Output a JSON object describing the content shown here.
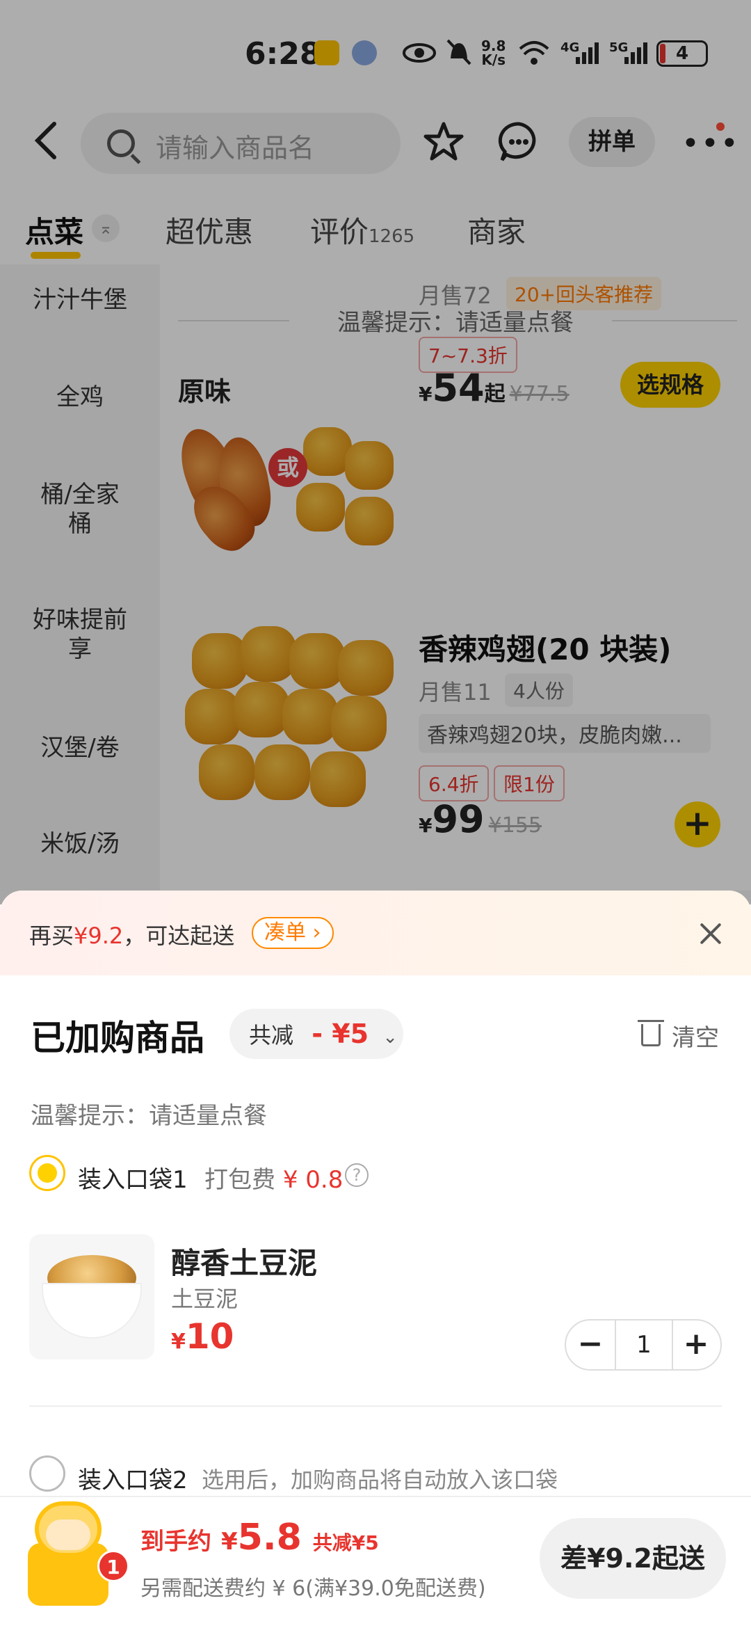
{
  "status_bar": {
    "time": "6:28",
    "speed_top": "9.8",
    "speed_bottom": "K/s",
    "net1": "4G",
    "net2": "5G",
    "battery": "4"
  },
  "header": {
    "search_placeholder": "请输入商品名",
    "pindan": "拼单"
  },
  "tabs": [
    {
      "label": "点菜",
      "sub": ""
    },
    {
      "label": "超优惠",
      "sub": ""
    },
    {
      "label": "评价",
      "sub": "1265"
    },
    {
      "label": "商家",
      "sub": ""
    }
  ],
  "sidebar": [
    "汁汁牛堡",
    "全鸡",
    "桶/全家桶",
    "好味提前享",
    "汉堡/卷",
    "米饭/汤"
  ],
  "menu": {
    "tip": "温馨提示：请适量点餐",
    "section": "原味",
    "items": [
      {
        "name": "",
        "sales": "月售72",
        "tag": "20+回头客推荐",
        "discount": "7~7.3折",
        "price_symbol": "¥",
        "price": "54",
        "price_suffix": "起",
        "old_price": "¥77.5",
        "action": "选规格",
        "or_badge": "或"
      },
      {
        "name": "香辣鸡翅(20 块装)",
        "sales": "月售11",
        "tag": "4人份",
        "desc": "香辣鸡翅20块，皮脆肉嫩...",
        "discount": "6.4折",
        "limit": "限1份",
        "price_symbol": "¥",
        "price": "99",
        "old_price": "¥155",
        "action": "+"
      }
    ]
  },
  "sheet": {
    "banner_pre": "再买",
    "banner_amount": "¥9.2",
    "banner_post": "，可达起送",
    "cou_label": "凑单 ›",
    "title": "已加购商品",
    "reduce_label": "共减",
    "reduce_value": "- ¥5",
    "clear_label": "清空",
    "warm_tip": "温馨提示：请适量点餐",
    "bag1": {
      "label": "装入口袋1",
      "fee_label": "打包费",
      "fee_value": "¥ 0.8",
      "help": "?"
    },
    "item": {
      "name": "醇香土豆泥",
      "sub": "土豆泥",
      "price_symbol": "¥",
      "price": "10",
      "qty": "1",
      "minus": "−",
      "plus": "+"
    },
    "bag2": {
      "label": "装入口袋2",
      "hint": "选用后，加购商品将自动放入该口袋"
    }
  },
  "bottom_bar": {
    "cart_count": "1",
    "final_label": "到手约",
    "final_symbol": "¥",
    "final_value": "5.8",
    "final_reduce": "共减¥5",
    "delivery": "另需配送费约 ¥ 6(满¥39.0免配送费)",
    "submit": "差¥9.2起送"
  },
  "colors": {
    "accent_yellow": "#ffd100",
    "price_red": "#e8342e",
    "tag_orange": "#ff7a00"
  }
}
